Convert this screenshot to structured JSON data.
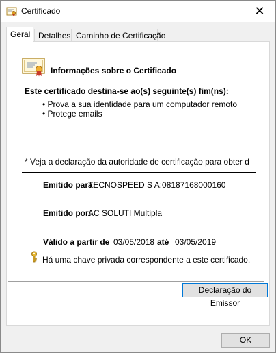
{
  "window": {
    "title": "Certificado",
    "close_glyph": "✕"
  },
  "tabs": [
    {
      "label": "Geral",
      "active": true
    },
    {
      "label": "Detalhes",
      "active": false
    },
    {
      "label": "Caminho de Certificação",
      "active": false
    }
  ],
  "general": {
    "heading": "Informações sobre o Certificado",
    "purpose_title": "Este certificado destina-se ao(s) seguinte(s) fim(ns):",
    "purposes": [
      "Prova a sua identidade para um computador remoto",
      "Protege emails"
    ],
    "note": "* Veja a declaração da autoridade de certificação para obter d",
    "issued_to_label": "Emitido para:",
    "issued_to_value": "TECNOSPEED S A:08187168000160",
    "issued_by_label": "Emitido por:",
    "issued_by_value": "AC SOLUTI Multipla",
    "valid_from_label": "Válido a partir de",
    "valid_from_value": "03/05/2018",
    "valid_to_label": "até",
    "valid_to_value": "03/05/2019",
    "private_key_text": "Há uma chave privada correspondente a este certificado."
  },
  "buttons": {
    "issuer_statement": "Declaração do Emissor",
    "ok": "OK"
  },
  "icons": {
    "title": "certificate-icon",
    "cert": "certificate-icon",
    "key": "key-icon"
  }
}
